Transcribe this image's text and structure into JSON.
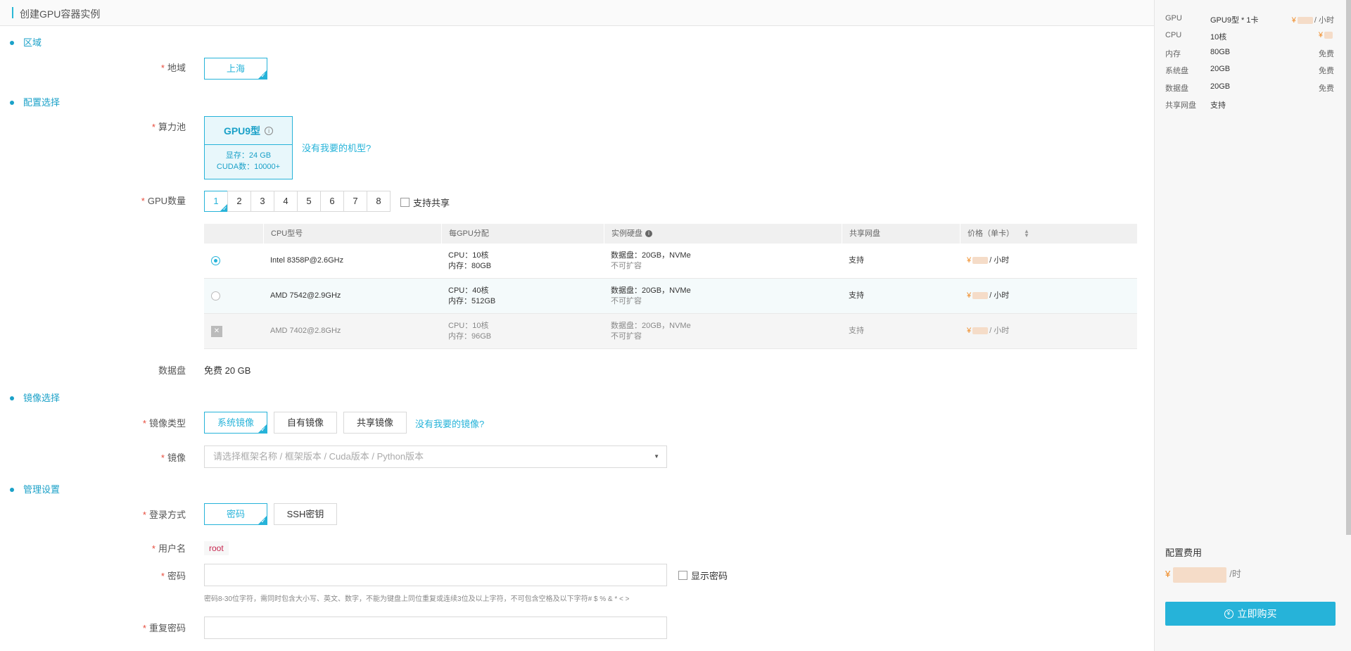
{
  "header": {
    "title": "创建GPU容器实例"
  },
  "sections": {
    "region": "区域",
    "config": "配置选择",
    "image": "镜像选择",
    "manage": "管理设置"
  },
  "region": {
    "label": "地域",
    "options": [
      "上海"
    ]
  },
  "pool": {
    "label": "算力池",
    "card_title": "GPU9型",
    "vram": "显存：24 GB",
    "cuda": "CUDA数：10000+",
    "link": "没有我要的机型?"
  },
  "gpu_count": {
    "label": "GPU数量",
    "options": [
      "1",
      "2",
      "3",
      "4",
      "5",
      "6",
      "7",
      "8"
    ],
    "share_label": "支持共享"
  },
  "table": {
    "headers": [
      "",
      "CPU型号",
      "每GPU分配",
      "实例硬盘",
      "共享网盘",
      "价格（单卡）"
    ],
    "rows": [
      {
        "cpu": "Intel 8358P@2.6GHz",
        "alloc1": "CPU：10核",
        "alloc2": "内存：80GB",
        "disk1": "数据盘：20GB，NVMe",
        "disk2": "不可扩容",
        "share": "支持",
        "price_unit": "/ 小时",
        "state": "selected"
      },
      {
        "cpu": "AMD 7542@2.9GHz",
        "alloc1": "CPU：40核",
        "alloc2": "内存：512GB",
        "disk1": "数据盘：20GB，NVMe",
        "disk2": "不可扩容",
        "share": "支持",
        "price_unit": "/ 小时",
        "state": "available"
      },
      {
        "cpu": "AMD 7402@2.8GHz",
        "alloc1": "CPU：10核",
        "alloc2": "内存：96GB",
        "disk1": "数据盘：20GB，NVMe",
        "disk2": "不可扩容",
        "share": "支持",
        "price_unit": "/ 小时",
        "state": "soldout"
      }
    ],
    "yen": "¥"
  },
  "data_disk": {
    "label": "数据盘",
    "value": "免费 20 GB"
  },
  "image_type": {
    "label": "镜像类型",
    "options": [
      "系统镜像",
      "自有镜像",
      "共享镜像"
    ],
    "link": "没有我要的镜像?"
  },
  "image": {
    "label": "镜像",
    "placeholder": "请选择框架名称 / 框架版本 / Cuda版本 / Python版本"
  },
  "login": {
    "label": "登录方式",
    "options": [
      "密码",
      "SSH密钥"
    ]
  },
  "username": {
    "label": "用户名",
    "value": "root"
  },
  "password": {
    "label": "密码",
    "show_label": "显示密码",
    "hint": "密码8-30位字符，需同时包含大小写、英文、数字，不能为键盘上同位重复或连续3位及以上字符，不可包含空格及以下字符# $ % & * < >"
  },
  "password_repeat": {
    "label": "重复密码"
  },
  "summary": {
    "items": [
      {
        "k": "GPU",
        "v": "GPU9型 * 1卡",
        "p": "/ 小时",
        "priced": true
      },
      {
        "k": "CPU",
        "v": "10核",
        "p": "",
        "priced": true
      },
      {
        "k": "内存",
        "v": "80GB",
        "p": "免费",
        "priced": false
      },
      {
        "k": "系统盘",
        "v": "20GB",
        "p": "免费",
        "priced": false
      },
      {
        "k": "数据盘",
        "v": "20GB",
        "p": "免费",
        "priced": false
      },
      {
        "k": "共享网盘",
        "v": "支持",
        "p": "",
        "priced": false
      }
    ],
    "fee_label": "配置费用",
    "fee_unit": "/时",
    "buy_label": "立即购买"
  },
  "colors": {
    "accent": "#26b3d9",
    "price": "#f08a24",
    "required": "#e74c3c"
  }
}
